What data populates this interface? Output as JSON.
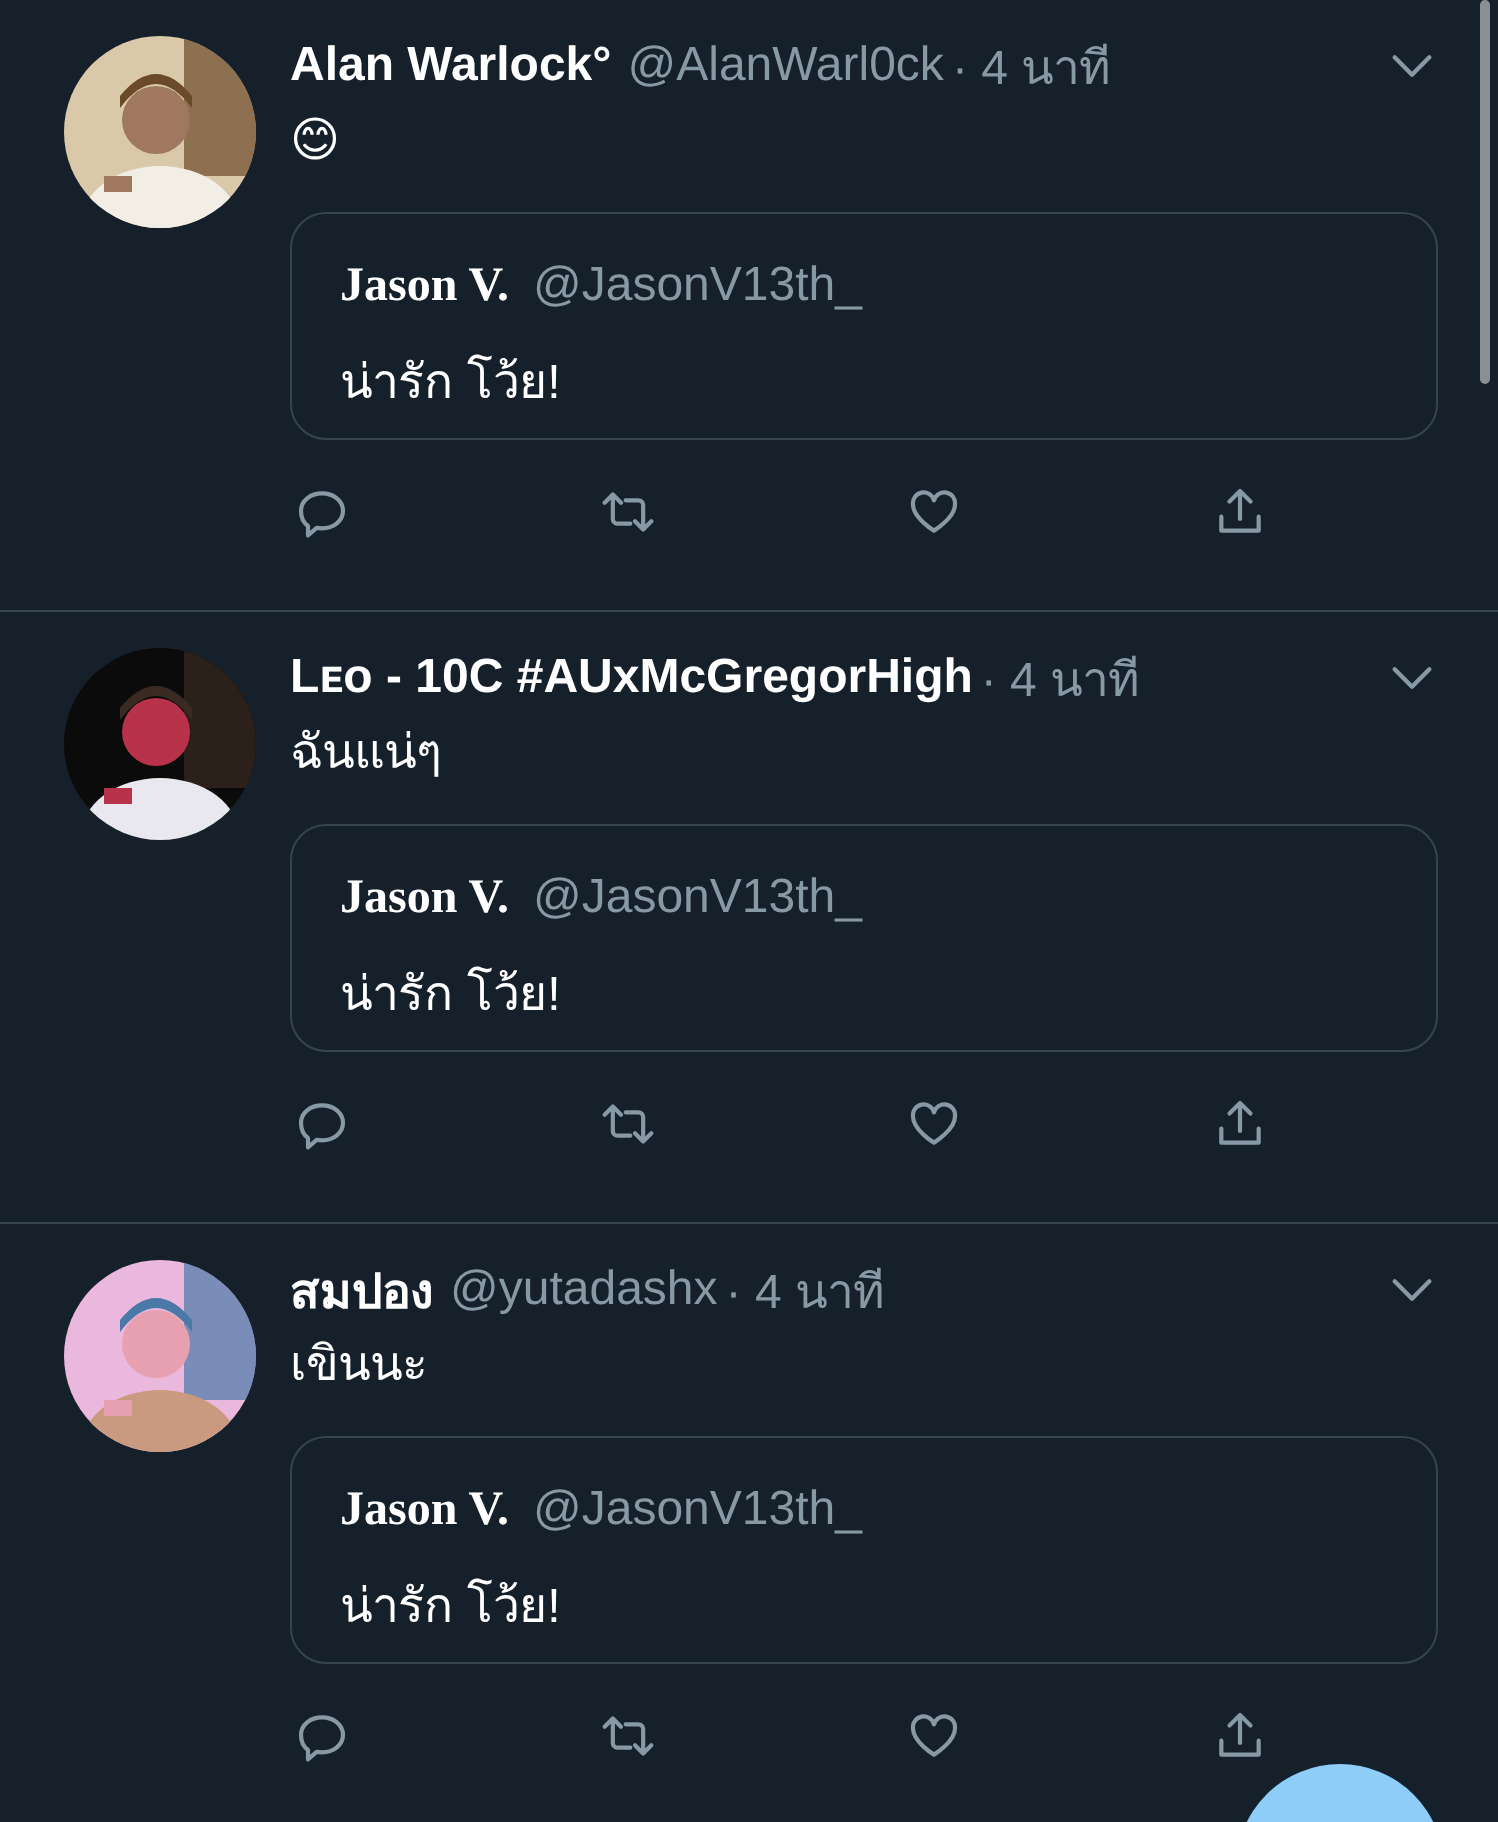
{
  "tweets": [
    {
      "name": "Alan Warlock°",
      "handle": "@AlanWarl0ck",
      "time": "· 4 นาที",
      "text": "😊",
      "quote": {
        "name": "Jason V.",
        "handle": "@JasonV13th_",
        "text": "น่ารัก โว้ย!"
      }
    },
    {
      "name": "Lᴇᴏ - 10C #AUxMcGregorHigh",
      "time": "· 4 นาที",
      "text": "ฉันแน่ๆ",
      "quote": {
        "name": "Jason V.",
        "handle": "@JasonV13th_",
        "text": "น่ารัก โว้ย!"
      }
    },
    {
      "name": "สมปอง",
      "handle": "@yutadashx",
      "time": "· 4 นาที",
      "text": "เขินนะ",
      "quote": {
        "name": "Jason V.",
        "handle": "@JasonV13th_",
        "text": "น่ารัก โว้ย!"
      }
    }
  ]
}
